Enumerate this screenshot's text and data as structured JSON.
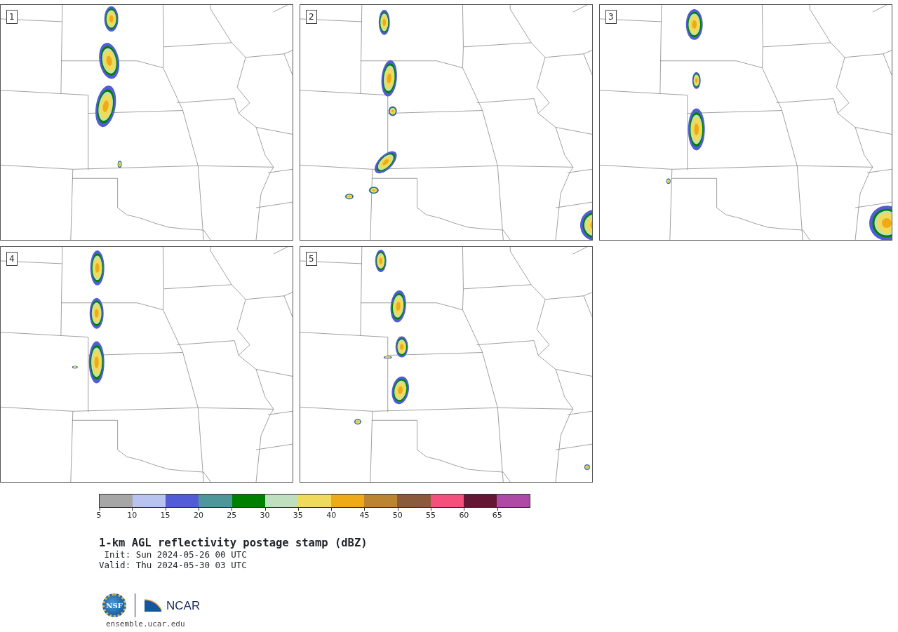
{
  "panels": [
    {
      "label": "1"
    },
    {
      "label": "2"
    },
    {
      "label": "3"
    },
    {
      "label": "4"
    },
    {
      "label": "5"
    }
  ],
  "colorbar": {
    "swatches": [
      {
        "color": "#a6a6a6"
      },
      {
        "color": "#b8c3ef"
      },
      {
        "color": "#525cd6"
      },
      {
        "color": "#4f969a"
      },
      {
        "color": "#008000"
      },
      {
        "color": "#bfdfbf"
      },
      {
        "color": "#efda5b"
      },
      {
        "color": "#efab17"
      },
      {
        "color": "#bb8430"
      },
      {
        "color": "#8b5a3c"
      },
      {
        "color": "#f5507d"
      },
      {
        "color": "#641734"
      },
      {
        "color": "#ad4aa6"
      }
    ],
    "ticks": [
      "5",
      "10",
      "15",
      "20",
      "25",
      "30",
      "35",
      "40",
      "45",
      "50",
      "55",
      "60",
      "65"
    ]
  },
  "title": "1-km AGL reflectivity postage stamp (dBZ)",
  "init": " Init: Sun 2024-05-26 00 UTC",
  "valid": "Valid: Thu 2024-05-30 03 UTC",
  "logo": {
    "nsf": "NSF",
    "ncar": "NCAR"
  },
  "site": "ensemble.ucar.edu"
}
